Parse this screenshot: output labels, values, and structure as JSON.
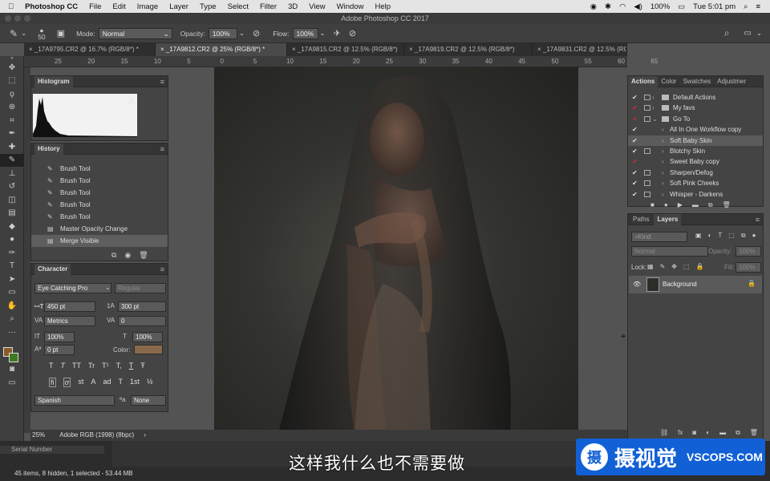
{
  "mac_menu": {
    "apple": "",
    "app": "Photoshop CC",
    "items": [
      "File",
      "Edit",
      "Image",
      "Layer",
      "Type",
      "Select",
      "Filter",
      "3D",
      "View",
      "Window",
      "Help"
    ],
    "battery": "100%",
    "clock": "Tue 5:01 pm"
  },
  "window": {
    "title": "Adobe Photoshop CC 2017"
  },
  "options": {
    "brush_size": "50",
    "mode_label": "Mode:",
    "mode_value": "Normal",
    "opacity_label": "Opacity:",
    "opacity_value": "100%",
    "flow_label": "Flow:",
    "flow_value": "100%"
  },
  "tabs": [
    "_17A9795.CR2 @ 16.7% (RGB/8*) *",
    "_17A9812.CR2 @ 25% (RGB/8*) *",
    "_17A9815.CR2 @ 12.5% (RGB/8*)",
    "_17A9819.CR2 @ 12.5% (RGB/8*)",
    "_17A9831.CR2 @ 12.5% (RGB/8*)"
  ],
  "ruler_top": [
    "25",
    "20",
    "15",
    "10",
    "5",
    "0",
    "5",
    "10",
    "15",
    "20",
    "25",
    "30",
    "35",
    "40",
    "45",
    "50",
    "55",
    "60",
    "65"
  ],
  "histogram": {
    "title": "Histogram"
  },
  "history": {
    "title": "History",
    "items": [
      "Brush Tool",
      "Brush Tool",
      "Brush Tool",
      "Brush Tool",
      "Brush Tool",
      "Master Opacity Change",
      "Merge Visible"
    ]
  },
  "character": {
    "title": "Character",
    "font_family": "Eye Catching Pro",
    "font_style": "Regular",
    "size": "450 pt",
    "leading": "300 pt",
    "kerning": "Metrics",
    "tracking": "0",
    "vscale": "100%",
    "hscale": "100%",
    "baseline": "0 pt",
    "color_label": "Color:",
    "color": "#8a6a4a",
    "language": "Spanish",
    "aa_label": "ªa",
    "aa_value": "None",
    "glyphs": [
      "T",
      "T",
      "TT",
      "Tr",
      "T¹",
      "T,",
      "T",
      "Ŧ"
    ],
    "opentype": [
      "fi",
      "ơ",
      "st",
      "A",
      "ad",
      "T",
      "1st",
      "½"
    ]
  },
  "status": {
    "zoom": "25%",
    "profile": "Adobe RGB (1998) (8bpc)"
  },
  "bottom": {
    "serial": "Serial Number",
    "info": "45 items, 8 hidden, 1 selected - 53.44 MB"
  },
  "actions_panel": {
    "tabs": [
      "Actions",
      "Color",
      "Swatches",
      "Adjustmer"
    ],
    "items": [
      {
        "label": "Default Actions",
        "level": 0,
        "folder": true,
        "red": false,
        "box": true
      },
      {
        "label": "My favs",
        "level": 0,
        "folder": true,
        "red": true,
        "box": true
      },
      {
        "label": "Go To",
        "level": 0,
        "folder": true,
        "red": true,
        "box": true
      },
      {
        "label": "All In One Workflow copy",
        "level": 1,
        "folder": false,
        "red": false,
        "box": false
      },
      {
        "label": "Soft Baby Skin",
        "level": 1,
        "folder": false,
        "red": false,
        "box": false,
        "selected": true
      },
      {
        "label": "Blotchy Skin",
        "level": 1,
        "folder": false,
        "red": false,
        "box": true
      },
      {
        "label": "Sweet Baby copy",
        "level": 1,
        "folder": false,
        "red": true,
        "box": false
      },
      {
        "label": "Sharpen/Defog",
        "level": 1,
        "folder": false,
        "red": false,
        "box": true
      },
      {
        "label": "Soft Pink Cheeks",
        "level": 1,
        "folder": false,
        "red": false,
        "box": true
      },
      {
        "label": "Whisper - Darkens",
        "level": 1,
        "folder": false,
        "red": false,
        "box": true
      }
    ]
  },
  "layers_panel": {
    "tabs": [
      "Paths",
      "Layers"
    ],
    "kind": "Kind",
    "blend": "Normal",
    "opacity_label": "Opacity:",
    "opacity": "100%",
    "lock_label": "Lock:",
    "fill_label": "Fill:",
    "fill": "100%",
    "layer_name": "Background"
  },
  "subtitle": "这样我什么也不需要做",
  "watermark": {
    "brand": "摄视觉",
    "url": "VSCOPS.COM",
    "logo": "摄"
  }
}
